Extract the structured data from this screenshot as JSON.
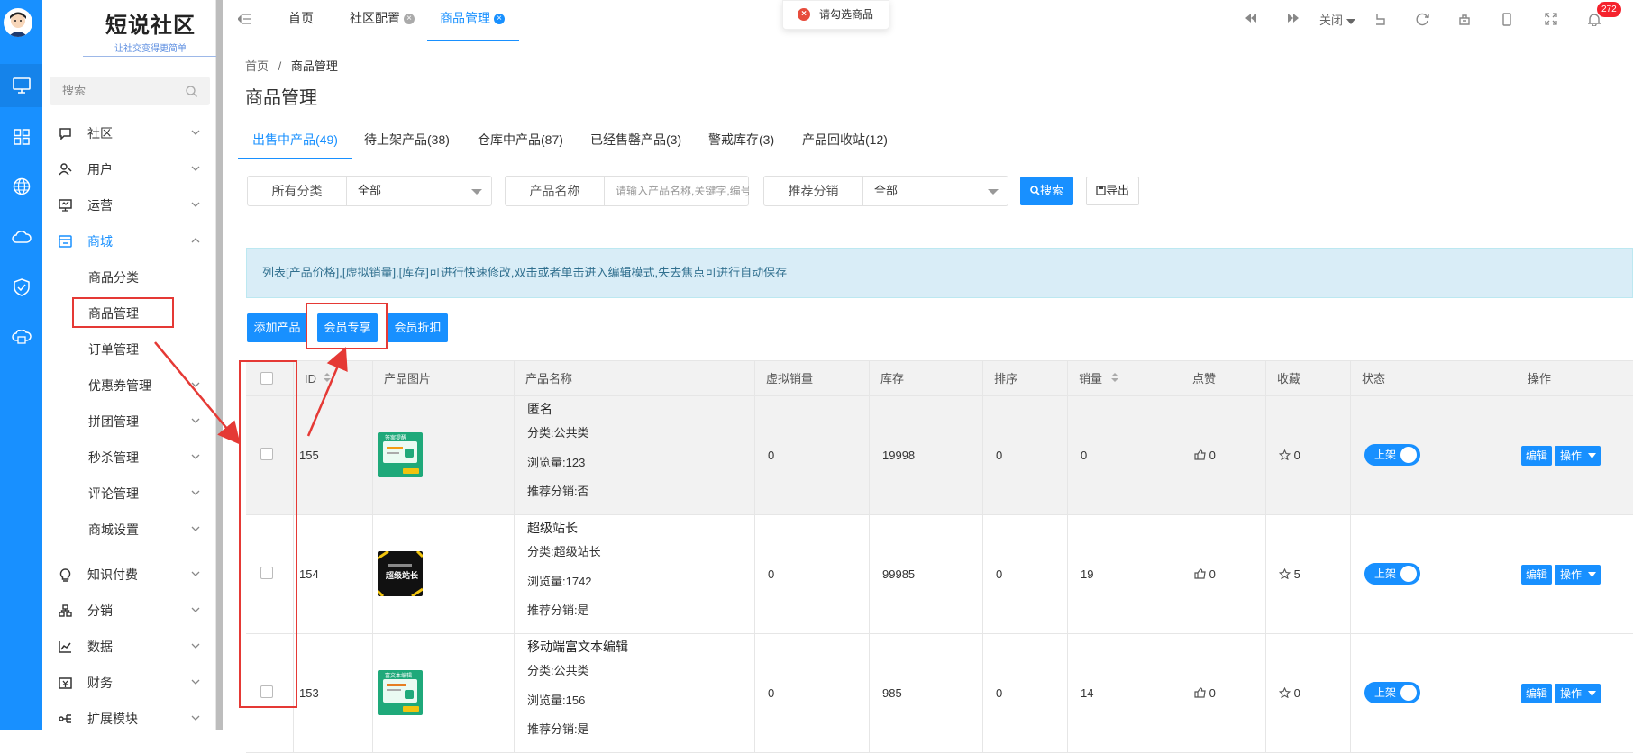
{
  "sidebar": {
    "logo_title": "短说社区",
    "logo_slogan": "让社交变得更简单",
    "search_placeholder": "搜索",
    "menu": [
      {
        "label": "社区",
        "icon": "chat-icon"
      },
      {
        "label": "用户",
        "icon": "user-icon"
      },
      {
        "label": "运营",
        "icon": "monitor-icon"
      },
      {
        "label": "商城",
        "icon": "store-icon"
      },
      {
        "label": "知识付费",
        "icon": "bulb-icon"
      },
      {
        "label": "分销",
        "icon": "network-icon"
      },
      {
        "label": "数据",
        "icon": "chart-icon"
      },
      {
        "label": "财务",
        "icon": "wallet-icon"
      },
      {
        "label": "扩展模块",
        "icon": "extend-icon"
      }
    ],
    "store_sub": [
      "商品分类",
      "商品管理",
      "订单管理",
      "优惠券管理",
      "拼团管理",
      "秒杀管理",
      "评论管理",
      "商城设置"
    ]
  },
  "topbar": {
    "tabs": [
      "首页",
      "社区配置",
      "商品管理"
    ],
    "close_label": "关闭",
    "notification_count": "272"
  },
  "toast": {
    "message": "请勾选商品"
  },
  "breadcrumb": {
    "home": "首页",
    "separator": "/",
    "current": "商品管理"
  },
  "page_title": "商品管理",
  "product_tabs": [
    "出售中产品(49)",
    "待上架产品(38)",
    "仓库中产品(87)",
    "已经售罄产品(3)",
    "警戒库存(3)",
    "产品回收站(12)"
  ],
  "filters": {
    "category_label": "所有分类",
    "category_value": "全部",
    "name_label": "产品名称",
    "name_placeholder": "请输入产品名称,关键字,编号",
    "dist_label": "推荐分销",
    "dist_value": "全部",
    "search_button": "搜索",
    "export_button": "导出"
  },
  "alert": "列表[产品价格],[虚拟销量],[库存]可进行快速修改,双击或者单击进入编辑模式,失去焦点可进行自动保存",
  "actions": {
    "add": "添加产品",
    "member_only": "会员专享",
    "member_discount": "会员折扣"
  },
  "table": {
    "headers": [
      "ID",
      "产品图片",
      "产品名称",
      "虚拟销量",
      "库存",
      "排序",
      "销量",
      "点赞",
      "收藏",
      "状态",
      "操作"
    ],
    "rows": [
      {
        "id": "155",
        "name": "匿名",
        "category": "分类:公共类",
        "views": "浏览量:123",
        "dist": "推荐分销:否",
        "virtual_sales": "0",
        "stock": "19998",
        "sort": "0",
        "sales": "0",
        "likes": "0",
        "favs": "0",
        "status": "上架",
        "img": "green",
        "thumb_text": "答案提醒"
      },
      {
        "id": "154",
        "name": "超级站长",
        "category": "分类:超级站长",
        "views": "浏览量:1742",
        "dist": "推荐分销:是",
        "virtual_sales": "0",
        "stock": "99985",
        "sort": "0",
        "sales": "19",
        "likes": "0",
        "favs": "5",
        "status": "上架",
        "img": "black",
        "thumb_text": "超级站长"
      },
      {
        "id": "153",
        "name": "移动端富文本编辑",
        "category": "分类:公共类",
        "views": "浏览量:156",
        "dist": "推荐分销:是",
        "virtual_sales": "0",
        "stock": "985",
        "sort": "0",
        "sales": "14",
        "likes": "0",
        "favs": "0",
        "status": "上架",
        "img": "green",
        "thumb_text": "富文本编辑"
      }
    ],
    "edit_label": "编辑",
    "ops_label": "操作"
  },
  "colors": {
    "primary": "#1890ff",
    "annotation": "#e53935",
    "alert_bg": "#d9edf7"
  }
}
